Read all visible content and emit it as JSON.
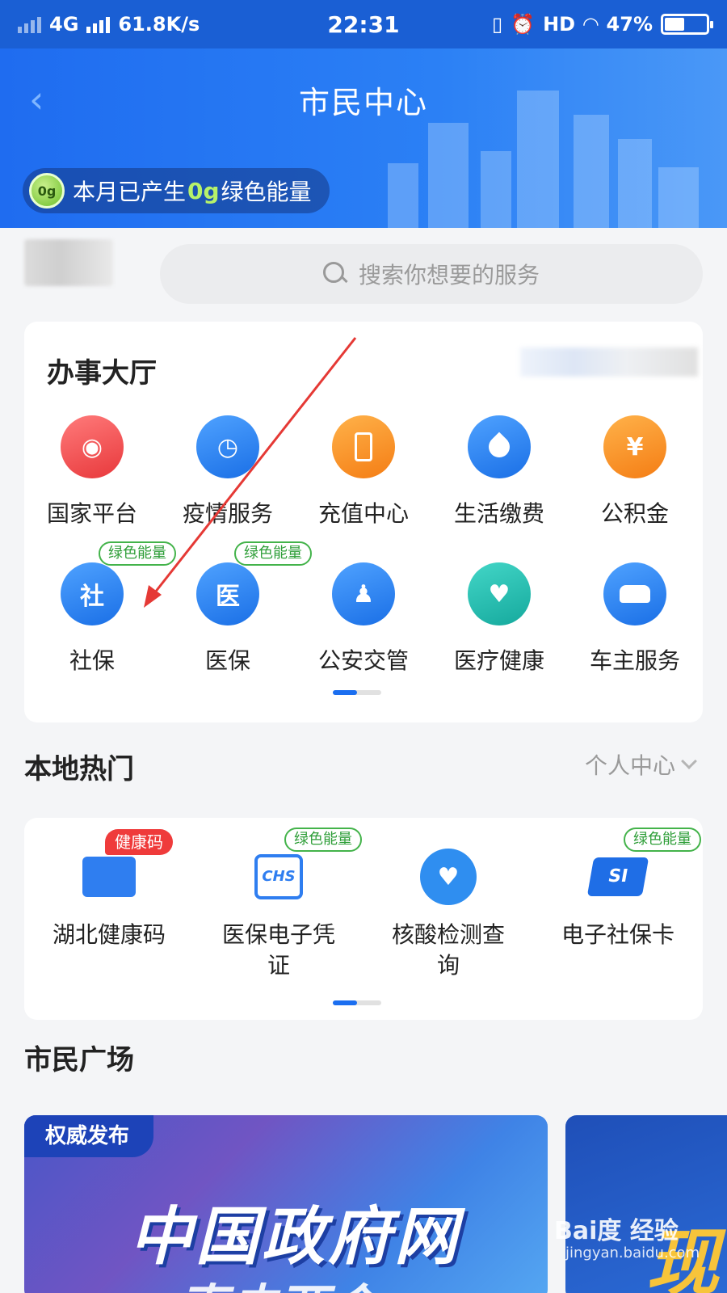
{
  "status_bar": {
    "network": "4G",
    "speed": "61.8K/s",
    "time": "22:31",
    "hd": "HD",
    "battery": "47%",
    "battery_level": 0.47
  },
  "header": {
    "title": "市民中心",
    "energy": {
      "badge": "0g",
      "prefix": "本月已产生",
      "value": "0g",
      "suffix": "绿色能量"
    }
  },
  "search": {
    "placeholder": "搜索你想要的服务"
  },
  "service_hall": {
    "title": "办事大厅",
    "row1": [
      {
        "label": "国家平台",
        "icon": "national-emblem-icon",
        "glyph": "◉"
      },
      {
        "label": "疫情服务",
        "icon": "clock-refresh-icon",
        "glyph": "◷"
      },
      {
        "label": "充值中心",
        "icon": "phone-icon",
        "glyph": "▯"
      },
      {
        "label": "生活缴费",
        "icon": "water-drop-icon",
        "glyph": "💧"
      },
      {
        "label": "公积金",
        "icon": "house-yuan-icon",
        "glyph": "¥"
      }
    ],
    "row2": [
      {
        "label": "社保",
        "icon": "shield-she-icon",
        "glyph": "社",
        "badge": "绿色能量"
      },
      {
        "label": "医保",
        "icon": "shield-yi-icon",
        "glyph": "医",
        "badge": "绿色能量"
      },
      {
        "label": "公安交管",
        "icon": "police-icon",
        "glyph": "♟"
      },
      {
        "label": "医疗健康",
        "icon": "heart-stethoscope-icon",
        "glyph": "♥"
      },
      {
        "label": "车主服务",
        "icon": "car-icon",
        "glyph": "🚗"
      }
    ]
  },
  "local_hot": {
    "title": "本地热门",
    "link": "个人中心",
    "items": [
      {
        "label": "湖北健康码",
        "icon": "id-card-icon",
        "badge_red": "健康码"
      },
      {
        "label": "医保电子凭证",
        "icon": "chs-icon",
        "glyph": "CHS",
        "badge": "绿色能量"
      },
      {
        "label": "核酸检测查询",
        "icon": "heart-plus-icon"
      },
      {
        "label": "电子社保卡",
        "icon": "si-card-icon",
        "glyph": "SI",
        "badge": "绿色能量"
      }
    ]
  },
  "plaza": {
    "title": "市民广场",
    "tag": "权威发布",
    "headline": "中国政府网",
    "subline": "直击两会",
    "card2_text": "现"
  },
  "watermark": {
    "brand": "Bai度 经验",
    "url": "jingyan.baidu.com"
  },
  "colors": {
    "primary": "#1f6cf0",
    "green_badge": "#43b34a",
    "red_badge": "#ef3b3b",
    "arrow": "#e53935"
  }
}
